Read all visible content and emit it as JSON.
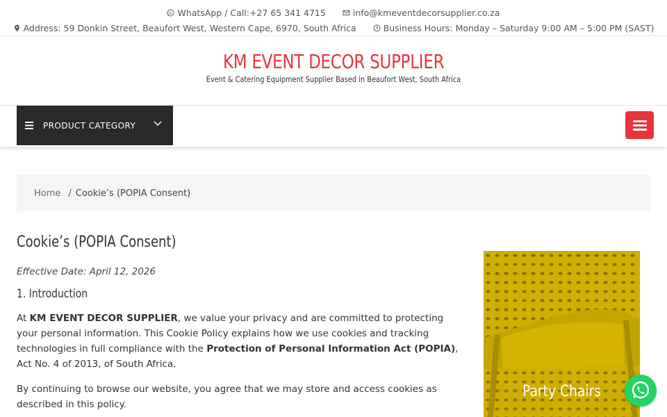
{
  "topbar": {
    "whatsapp": "WhatsApp / Call:+27 65 341 4715",
    "email": "info@kmeventdecorsupplier.co.za",
    "address": "Address: 59 Donkin Street, Beaufort West, Western Cape, 6970, South Africa",
    "hours": "Business Hours: Monday – Saturday 9:00 AM – 5:00 PM (SAST)"
  },
  "brand": {
    "title": "KM EVENT DECOR SUPPLIER",
    "tagline": "Event & Catering Equipment Supplier Based in Beaufort West, South Africa",
    "accent": "#e8333b"
  },
  "nav": {
    "category_label": "PRODUCT CATEGORY"
  },
  "breadcrumb": {
    "home": "Home",
    "separator": "/",
    "current": "Cookie’s (POPIA Consent)"
  },
  "content": {
    "title": "Cookie’s (POPIA Consent)",
    "effective": "Effective Date: April 12, 2026",
    "section1": "1. Introduction",
    "p1_a": "At ",
    "p1_company": "KM EVENT DECOR SUPPLIER",
    "p1_b": ", we value your privacy and are committed to protecting your personal information. This Cookie Policy explains how we use cookies and tracking technologies in full compliance with the ",
    "p1_act": "Protection of Personal Information Act (POPIA)",
    "p1_c": ", Act No. 4 of 2013, of South Africa.",
    "p2": "By continuing to browse our website, you agree that we may store and access cookies as described in this policy."
  },
  "sidebar": {
    "promo_caption": "Party Chairs",
    "promo_color": "#d9b800"
  },
  "icons": {
    "whatsapp_float": "whatsapp-icon",
    "whatsapp_color": "#25d366"
  }
}
